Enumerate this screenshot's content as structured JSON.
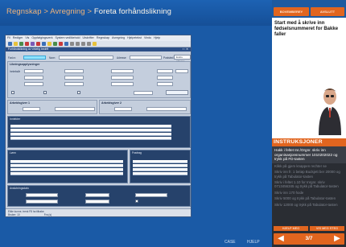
{
  "header": {
    "crumb_1": "Regnskap",
    "sep_1": " > ",
    "crumb_2": "Avregning",
    "sep_2": " > ",
    "crumb_3": "Foreta forhåndslikning"
  },
  "right_tabs": {
    "tab_1": "BOVEMBEREY",
    "tab_2": "AVSLUTT"
  },
  "help_text": "Start med å skrive inn fødselsnummeret for Bakke faller",
  "instructions": {
    "title": "INSTRUKSJONER",
    "active_step": "Hakk i feltet Inr./Orgnr. skriv inn organisasjonsnummer 1010202022 og trykk på FD-tasten",
    "steps": [
      "Klikk på gjem knappen rechter se",
      "Skriv inn fr. 1 beløp Budsjett ber 20000 og trykk på Tabulator-tasten",
      "Skriv i feltet 1.10 for Inrgnr. skriv 0713456345 og trykk på Tabulator-tasten",
      "Skriv inn 170 hode",
      "Skriv 5000 og trykk på Tabulator-tasten",
      "Skriv 12000 og trykk på Tabulator-tasten"
    ]
  },
  "nav": {
    "link_1": "HJELP MEG",
    "link_2": "VIS MEG STEG",
    "page": "3/7"
  },
  "footer": {
    "link_1": "CASE",
    "link_2": "HJELP"
  },
  "app": {
    "menu": [
      "Fil",
      "Rediger",
      "Vis",
      "Oppfølgingsverk",
      "System vedlikehold",
      "Utskrifter",
      "Regnskap",
      "Avregning",
      "Hjelpetekst",
      "Vindu",
      "Hjelp"
    ],
    "doc_title": "Forhåndslikning av virkelig bedrift",
    "label_fodsnr": "Fød.nr.",
    "label_navn": "Navn",
    "label_adresse": "Adresse",
    "label_poststed": "Poststed",
    "btn_adressepost": "Endre adresse",
    "sec_likning": "Likningsopplysninger",
    "label_inntekt": "Innteksår",
    "label_utbetalt": "Utbetalt",
    "label_skattetrekk": "Skattetrekk",
    "label_bruttoinntekt": "Bruttoinntekt",
    "label_kommune": "Kommune",
    "label_adressebyfylke": "Fylke",
    "sec_arbeid1": "Arbeidsgiver 1",
    "sec_arbeid2": "Arbeidsgiver 2",
    "sec_inntekter": "Inntekter",
    "sec_lonn": "Lønn",
    "sec_fradrag": "Fradrag",
    "sec_avslutt": "Avslutningsdato",
    "status_left": "Elkle kunne, trenk F8 ha tilbake.",
    "status_mid": "Bruker: 10",
    "status_right": "Fra (s)"
  }
}
